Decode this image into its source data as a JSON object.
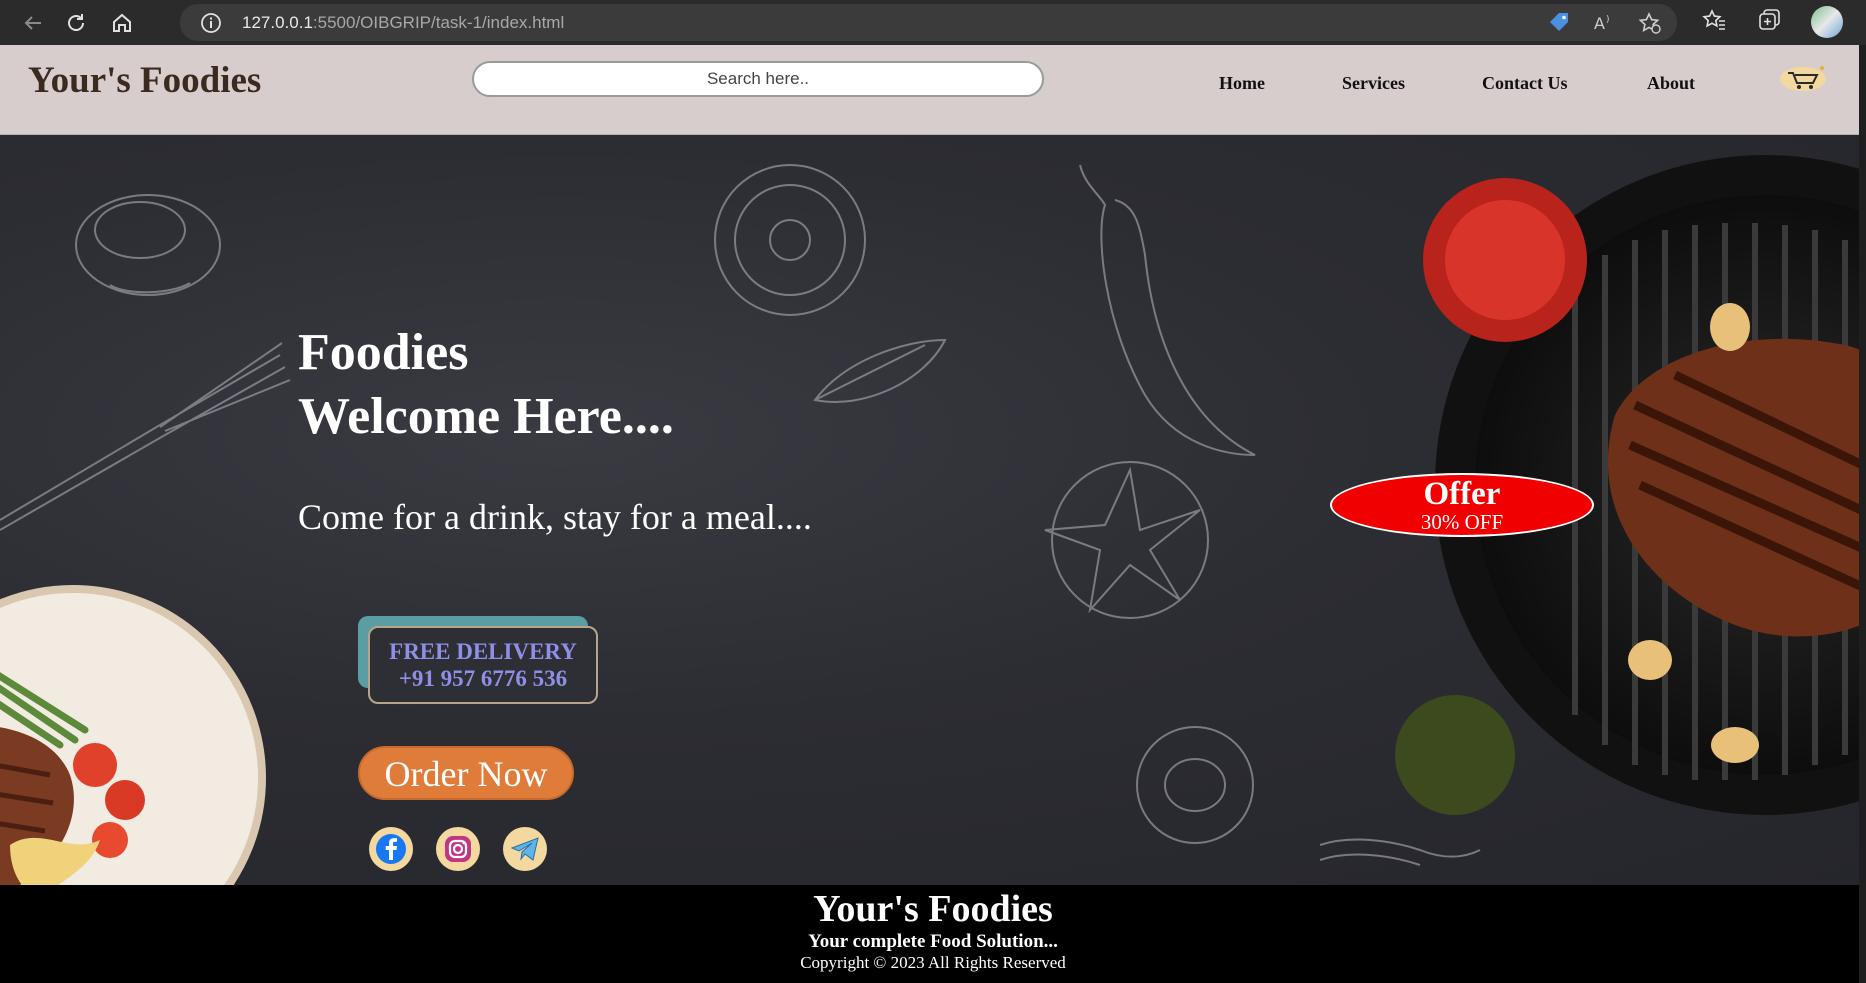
{
  "browser": {
    "url_host": "127.0.0.1",
    "url_rest": ":5500/OIBGRIP/task-1/index.html",
    "icons": [
      "back-icon",
      "refresh-icon",
      "home-icon",
      "info-icon",
      "tag-icon",
      "read-aloud-icon",
      "favorite-add-icon",
      "favorites-icon",
      "collections-icon",
      "profile-avatar"
    ]
  },
  "navbar": {
    "brand": "Your's Foodies",
    "search_placeholder": "Search here..",
    "links": [
      "Home",
      "Services",
      "Contact Us",
      "About"
    ],
    "cart_icon": "cart-icon"
  },
  "hero": {
    "title_line1": "Foodies",
    "title_line2": "Welcome Here....",
    "subtitle": "Come for a drink, stay for a meal....",
    "delivery_line1": "FREE DELIVERY",
    "delivery_line2": "+91 957 6776 536",
    "order_button": "Order Now",
    "social": [
      "facebook-icon",
      "instagram-icon",
      "telegram-icon"
    ],
    "offer_title": "Offer",
    "offer_text": "30% OFF"
  },
  "footer": {
    "title": "Your's Foodies",
    "tagline": "Your complete Food Solution...",
    "copyright": "Copyright © 2023 All Rights Reserved"
  },
  "colors": {
    "navbar_bg": "#d8cdcd",
    "hero_bg": "#2c2d33",
    "order_button": "#e07c3a",
    "offer_bg": "#f00000",
    "delivery_text": "#8f8fe8",
    "footer_bg": "#000000"
  }
}
